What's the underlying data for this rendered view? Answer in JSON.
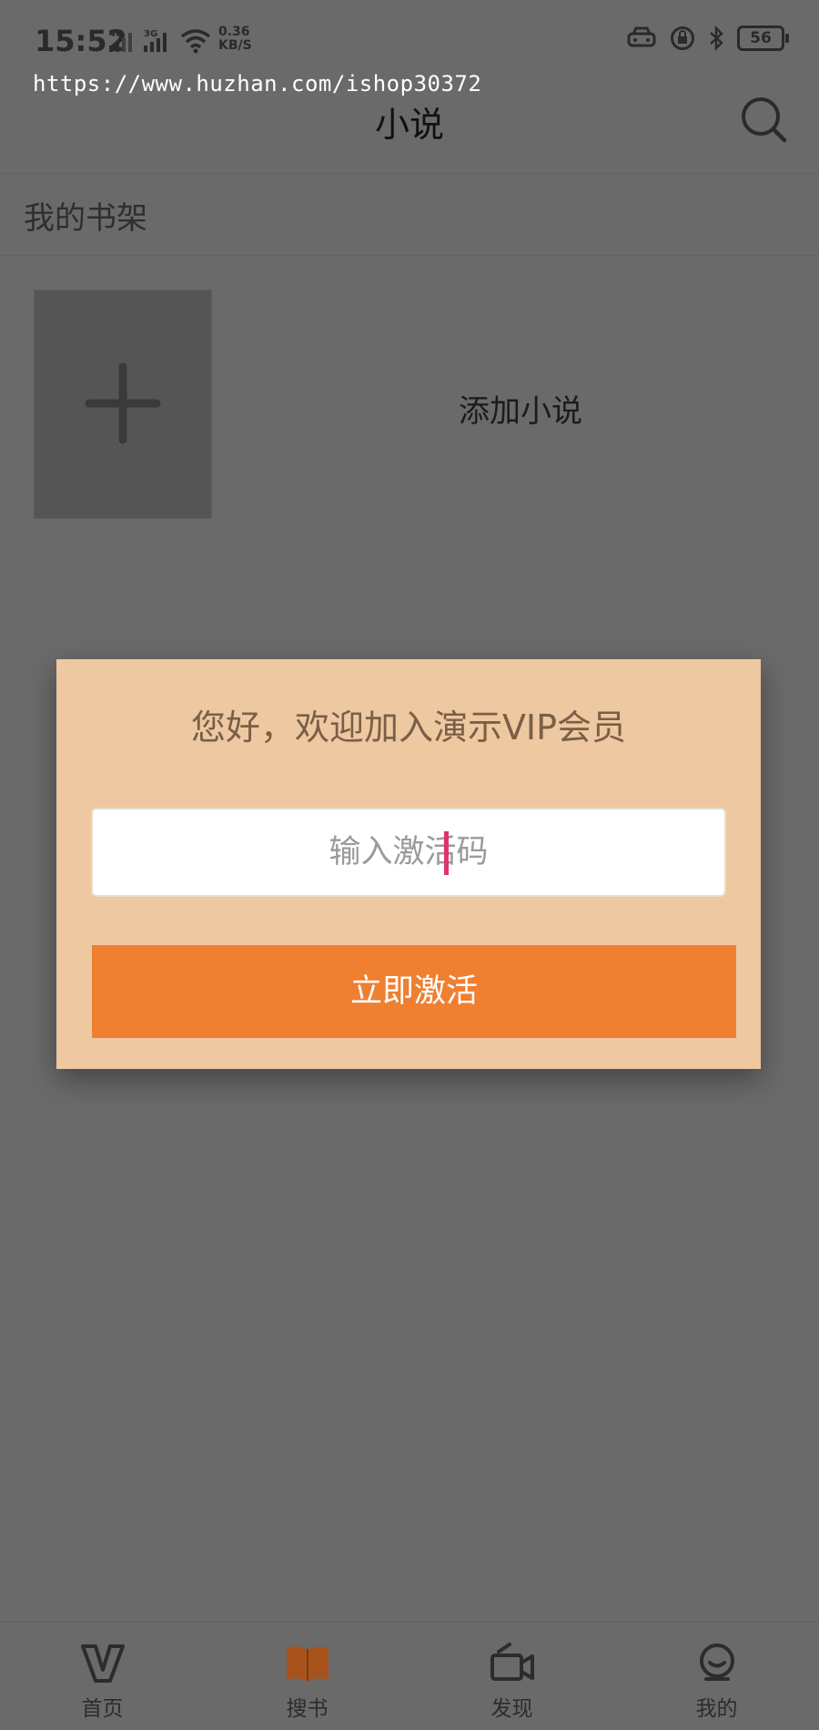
{
  "status_bar": {
    "time": "15:52",
    "network_1": "4G",
    "network_2": "3G",
    "speed_value": "0.36",
    "speed_unit": "KB/S",
    "battery": "56"
  },
  "watermark": "https://www.huzhan.com/ishop30372",
  "header": {
    "title": "小说"
  },
  "bookshelf": {
    "section_title": "我的书架",
    "add_label": "添加小说"
  },
  "dialog": {
    "title": "您好，欢迎加入演示VIP会员",
    "input_placeholder": "输入激活码",
    "button_label": "立即激活"
  },
  "tabs": [
    {
      "label": "首页",
      "icon": "v-logo-icon"
    },
    {
      "label": "搜书",
      "icon": "book-icon",
      "active": true
    },
    {
      "label": "发现",
      "icon": "video-camera-icon"
    },
    {
      "label": "我的",
      "icon": "profile-icon"
    }
  ],
  "colors": {
    "overlay_bg": "#6a6a6a",
    "dialog_bg": "#eec8a0",
    "accent": "#ef7f31",
    "caret": "#e0336a",
    "active_tab_icon": "#a8531b"
  }
}
